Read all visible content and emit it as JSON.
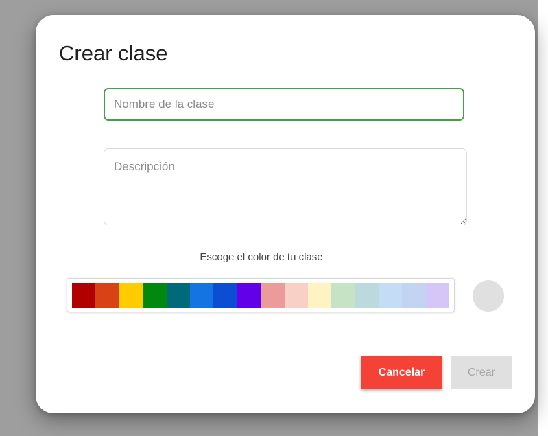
{
  "dialog": {
    "title": "Crear clase",
    "name_placeholder": "Nombre de la clase",
    "description_placeholder": "Descripción",
    "color_label": "Escoge el color de tu clase",
    "palette": [
      "#b00000",
      "#d84315",
      "#ffcc00",
      "#00880f",
      "#006a7a",
      "#1374e2",
      "#0b4ed4",
      "#6200ea",
      "#ec9b9b",
      "#f8d0c6",
      "#fff3c4",
      "#c6e3c6",
      "#bcd9de",
      "#c4dcf4",
      "#c3d3f2",
      "#d4c6f7"
    ],
    "selected_color": "#e0e0e0",
    "cancel_label": "Cancelar",
    "create_label": "Crear"
  }
}
